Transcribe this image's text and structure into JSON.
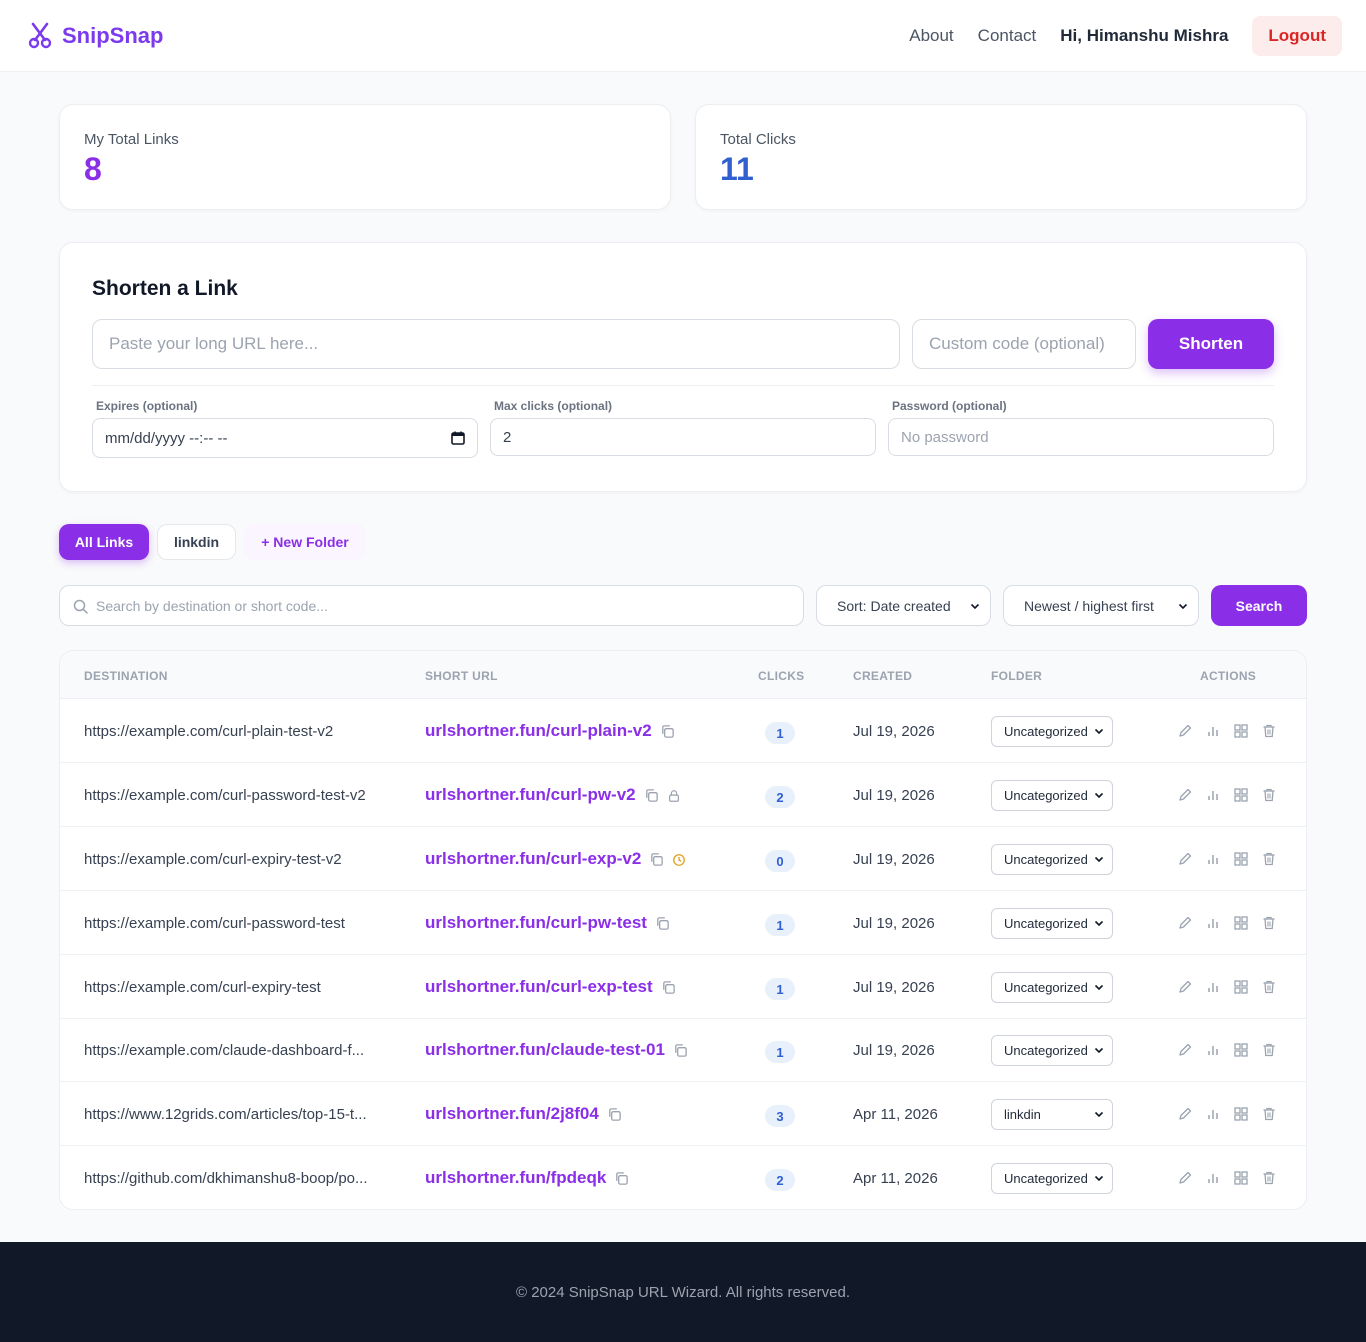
{
  "brand": {
    "name": "SnipSnap",
    "accent": "#8b2ee8"
  },
  "nav": {
    "about": "About",
    "contact": "Contact",
    "greeting": "Hi, Himanshu Mishra",
    "logout": "Logout"
  },
  "stats": {
    "links_label": "My Total Links",
    "links_value": "8",
    "clicks_label": "Total Clicks",
    "clicks_value": "11"
  },
  "shorten": {
    "title": "Shorten a Link",
    "url_placeholder": "Paste your long URL here...",
    "code_placeholder": "Custom code (optional)",
    "button": "Shorten",
    "expires_label": "Expires (optional)",
    "expires_value": "mm/dd/yyyy --:-- --",
    "max_label": "Max clicks (optional)",
    "max_value": "2",
    "password_label": "Password (optional)",
    "password_placeholder": "No password"
  },
  "folders": {
    "all": "All Links",
    "linkdin": "linkdin",
    "new": "+ New Folder"
  },
  "filters": {
    "search_placeholder": "Search by destination or short code...",
    "sort": "Sort: Date created",
    "order": "Newest / highest first",
    "search_button": "Search"
  },
  "table": {
    "headers": {
      "destination": "DESTINATION",
      "short_url": "SHORT URL",
      "clicks": "CLICKS",
      "created": "CREATED",
      "folder": "FOLDER",
      "actions": "ACTIONS"
    },
    "rows": [
      {
        "dest": "https://example.com/curl-plain-test-v2",
        "short": "urlshortner.fun/curl-plain-v2",
        "clicks": "1",
        "created": "Jul 19, 2026",
        "folder": "Uncategorized",
        "extra": ""
      },
      {
        "dest": "https://example.com/curl-password-test-v2",
        "short": "urlshortner.fun/curl-pw-v2",
        "clicks": "2",
        "created": "Jul 19, 2026",
        "folder": "Uncategorized",
        "extra": "lock"
      },
      {
        "dest": "https://example.com/curl-expiry-test-v2",
        "short": "urlshortner.fun/curl-exp-v2",
        "clicks": "0",
        "created": "Jul 19, 2026",
        "folder": "Uncategorized",
        "extra": "clock"
      },
      {
        "dest": "https://example.com/curl-password-test",
        "short": "urlshortner.fun/curl-pw-test",
        "clicks": "1",
        "created": "Jul 19, 2026",
        "folder": "Uncategorized",
        "extra": ""
      },
      {
        "dest": "https://example.com/curl-expiry-test",
        "short": "urlshortner.fun/curl-exp-test",
        "clicks": "1",
        "created": "Jul 19, 2026",
        "folder": "Uncategorized",
        "extra": ""
      },
      {
        "dest": "https://example.com/claude-dashboard-f...",
        "short": "urlshortner.fun/claude-test-01",
        "clicks": "1",
        "created": "Jul 19, 2026",
        "folder": "Uncategorized",
        "extra": ""
      },
      {
        "dest": "https://www.12grids.com/articles/top-15-t...",
        "short": "urlshortner.fun/2j8f04",
        "clicks": "3",
        "created": "Apr 11, 2026",
        "folder": "linkdin",
        "extra": ""
      },
      {
        "dest": "https://github.com/dkhimanshu8-boop/po...",
        "short": "urlshortner.fun/fpdeqk",
        "clicks": "2",
        "created": "Apr 11, 2026",
        "folder": "Uncategorized",
        "extra": ""
      }
    ]
  },
  "footer": {
    "text": "© 2024 SnipSnap URL Wizard. All rights reserved."
  }
}
